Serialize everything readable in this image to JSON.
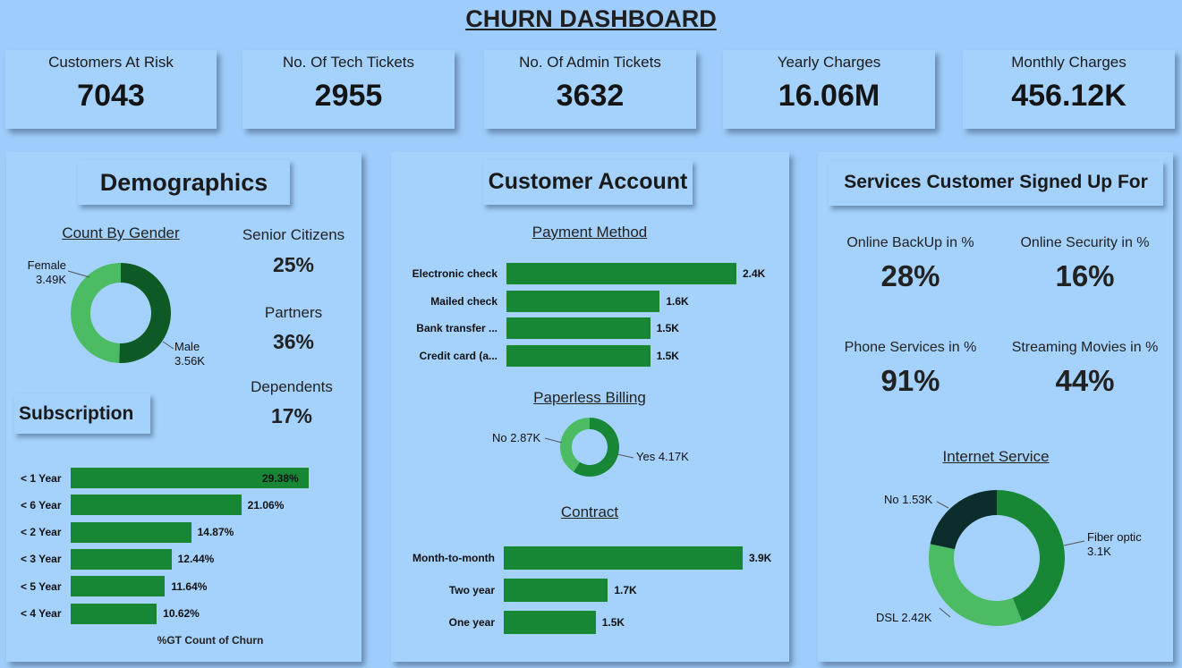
{
  "dashboard": {
    "title": "CHURN DASHBOARD"
  },
  "kpis": [
    {
      "label": "Customers At Risk",
      "value": "7043"
    },
    {
      "label": "No. Of Tech Tickets",
      "value": "2955"
    },
    {
      "label": "No. Of Admin Tickets",
      "value": "3632"
    },
    {
      "label": "Yearly Charges",
      "value": "16.06M"
    },
    {
      "label": "Monthly Charges",
      "value": "456.12K"
    }
  ],
  "demographics": {
    "title": "Demographics",
    "gender_title": "Count By Gender",
    "female_label": "Female",
    "female_value": "3.49K",
    "male_label": "Male",
    "male_value": "3.56K",
    "stats": [
      {
        "label": "Senior Citizens",
        "value": "25%"
      },
      {
        "label": "Partners",
        "value": "36%"
      },
      {
        "label": "Dependents",
        "value": "17%"
      }
    ]
  },
  "subscription": {
    "title": "Subscription",
    "axis_label": "%GT Count of Churn"
  },
  "customer_account": {
    "title": "Customer Account",
    "payment_title": "Payment Method",
    "paperless_title": "Paperless Billing",
    "paperless_no_label": "No 2.87K",
    "paperless_yes_label": "Yes 4.17K",
    "contract_title": "Contract"
  },
  "services": {
    "title": "Services Customer Signed Up For",
    "items": [
      {
        "label": "Online BackUp in %",
        "value": "28%"
      },
      {
        "label": "Online Security in %",
        "value": "16%"
      },
      {
        "label": "Phone Services in %",
        "value": "91%"
      },
      {
        "label": "Streaming Movies in %",
        "value": "44%"
      }
    ],
    "internet_title": "Internet Service",
    "no_label": "No 1.53K",
    "fiber_label": "Fiber optic",
    "fiber_value": "3.1K",
    "dsl_label": "DSL 2.42K"
  },
  "chart_data": [
    {
      "type": "pie",
      "title": "Count By Gender",
      "categories": [
        "Female",
        "Male"
      ],
      "values": [
        3.49,
        3.56
      ],
      "value_labels": [
        "3.49K",
        "3.56K"
      ],
      "colors": [
        "#4cbc64",
        "#0e5a25"
      ]
    },
    {
      "type": "bar",
      "orientation": "horizontal",
      "title": "",
      "categories": [
        "< 1 Year",
        "< 6 Year",
        "< 2 Year",
        "< 3 Year",
        "< 5 Year",
        "< 4 Year"
      ],
      "values": [
        29.38,
        21.06,
        14.87,
        12.44,
        11.64,
        10.62
      ],
      "value_labels": [
        "29.38%",
        "21.06%",
        "14.87%",
        "12.44%",
        "11.64%",
        "10.62%"
      ],
      "xlabel": "%GT Count of Churn",
      "color": "#178736"
    },
    {
      "type": "bar",
      "orientation": "horizontal",
      "title": "Payment Method",
      "categories": [
        "Electronic check",
        "Mailed check",
        "Bank transfer ...",
        "Credit card (a..."
      ],
      "values": [
        2.4,
        1.6,
        1.5,
        1.5
      ],
      "value_labels": [
        "2.4K",
        "1.6K",
        "1.5K",
        "1.5K"
      ],
      "color": "#178736"
    },
    {
      "type": "pie",
      "title": "Paperless Billing",
      "categories": [
        "No",
        "Yes"
      ],
      "values": [
        2.87,
        4.17
      ],
      "colors": [
        "#4cbc64",
        "#178736"
      ]
    },
    {
      "type": "bar",
      "orientation": "horizontal",
      "title": "Contract",
      "categories": [
        "Month-to-month",
        "Two year",
        "One year"
      ],
      "values": [
        3.9,
        1.7,
        1.5
      ],
      "value_labels": [
        "3.9K",
        "1.7K",
        "1.5K"
      ],
      "color": "#178736"
    },
    {
      "type": "pie",
      "title": "Internet Service",
      "categories": [
        "Fiber optic",
        "DSL",
        "No"
      ],
      "values": [
        3.1,
        2.42,
        1.53
      ],
      "colors": [
        "#178736",
        "#4cbc64",
        "#0b2e2a"
      ]
    }
  ]
}
